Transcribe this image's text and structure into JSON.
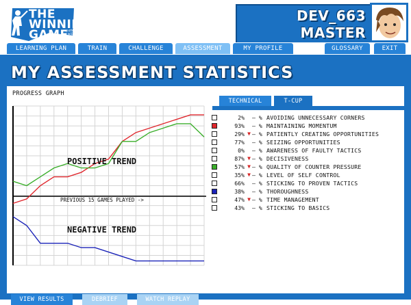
{
  "app": {
    "logo_title_line1": "THE",
    "logo_title_line2": "WINNING",
    "logo_title_line3": "GAME",
    "logo_tagline": "THINK LIKE A WINNER"
  },
  "user": {
    "name": "DEV_663",
    "rank": "MASTER"
  },
  "nav": {
    "tabs": [
      {
        "label": "LEARNING PLAN",
        "active": false
      },
      {
        "label": "TRAIN",
        "active": false
      },
      {
        "label": "CHALLENGE",
        "active": false
      },
      {
        "label": "ASSESSMENT",
        "active": true
      },
      {
        "label": "MY PROFILE",
        "active": false
      },
      {
        "label": "GLOSSARY",
        "active": false
      },
      {
        "label": "EXIT",
        "active": false
      }
    ]
  },
  "page": {
    "title": "MY ASSESSMENT STATISTICS"
  },
  "graph": {
    "label": "PROGRESS GRAPH",
    "positive_label": "POSITIVE TREND",
    "negative_label": "NEGATIVE TREND",
    "axis_caption": "PREVIOUS 15 GAMES PLAYED ->"
  },
  "chart_data": {
    "type": "line",
    "x": [
      1,
      2,
      3,
      4,
      5,
      6,
      7,
      8,
      9,
      10,
      11,
      12,
      13,
      14,
      15
    ],
    "series": [
      {
        "color": "#e0272d",
        "values": [
          2,
          3,
          6,
          8,
          8,
          9,
          11,
          12,
          16,
          18,
          19,
          20,
          21,
          22,
          22
        ]
      },
      {
        "color": "#3aae2a",
        "values": [
          7,
          6,
          8,
          10,
          11,
          10,
          10,
          11,
          16,
          16,
          18,
          19,
          20,
          20,
          17
        ]
      },
      {
        "color": "#1a22b8",
        "values": [
          -1,
          -3,
          -7,
          -7,
          -7,
          -8,
          -8,
          -9,
          -10,
          -11,
          -11,
          -11,
          -11,
          -11,
          -11
        ]
      }
    ],
    "ylim": [
      -12,
      24
    ],
    "grid": true
  },
  "stats_tabs": [
    {
      "label": "TECHNICAL",
      "active": false
    },
    {
      "label": "T-CUP",
      "active": true
    }
  ],
  "stats": [
    {
      "pct": "2%",
      "down": false,
      "name": "AVOIDING UNNECESSARY CORNERS",
      "color": ""
    },
    {
      "pct": "93%",
      "down": false,
      "name": "MAINTAINING MOMENTUM",
      "color": "#e0272d"
    },
    {
      "pct": "29%",
      "down": true,
      "name": "PATIENTLY CREATING OPPORTUNITIES",
      "color": ""
    },
    {
      "pct": "77%",
      "down": false,
      "name": "SEIZING OPPORTUNITIES",
      "color": ""
    },
    {
      "pct": "0%",
      "down": false,
      "name": "AWARENESS OF FAULTY TACTICS",
      "color": ""
    },
    {
      "pct": "87%",
      "down": true,
      "name": "DECISIVENESS",
      "color": ""
    },
    {
      "pct": "57%",
      "down": true,
      "name": "QUALITY OF COUNTER PRESSURE",
      "color": "#3aae2a"
    },
    {
      "pct": "35%",
      "down": true,
      "name": "LEVEL OF SELF CONTROL",
      "color": ""
    },
    {
      "pct": "66%",
      "down": false,
      "name": "STICKING TO PROVEN TACTICS",
      "color": ""
    },
    {
      "pct": "38%",
      "down": false,
      "name": "THOROUGHNESS",
      "color": "#1a22b8"
    },
    {
      "pct": "47%",
      "down": true,
      "name": "TIME MANAGEMENT",
      "color": ""
    },
    {
      "pct": "43%",
      "down": false,
      "name": "STICKING TO BASICS",
      "color": ""
    }
  ],
  "stat_dash": "— %",
  "arrow_glyph": "▼",
  "buttons": {
    "view_results": "VIEW RESULTS",
    "debrief": "DEBRIEF",
    "watch_replay": "WATCH REPLAY"
  }
}
